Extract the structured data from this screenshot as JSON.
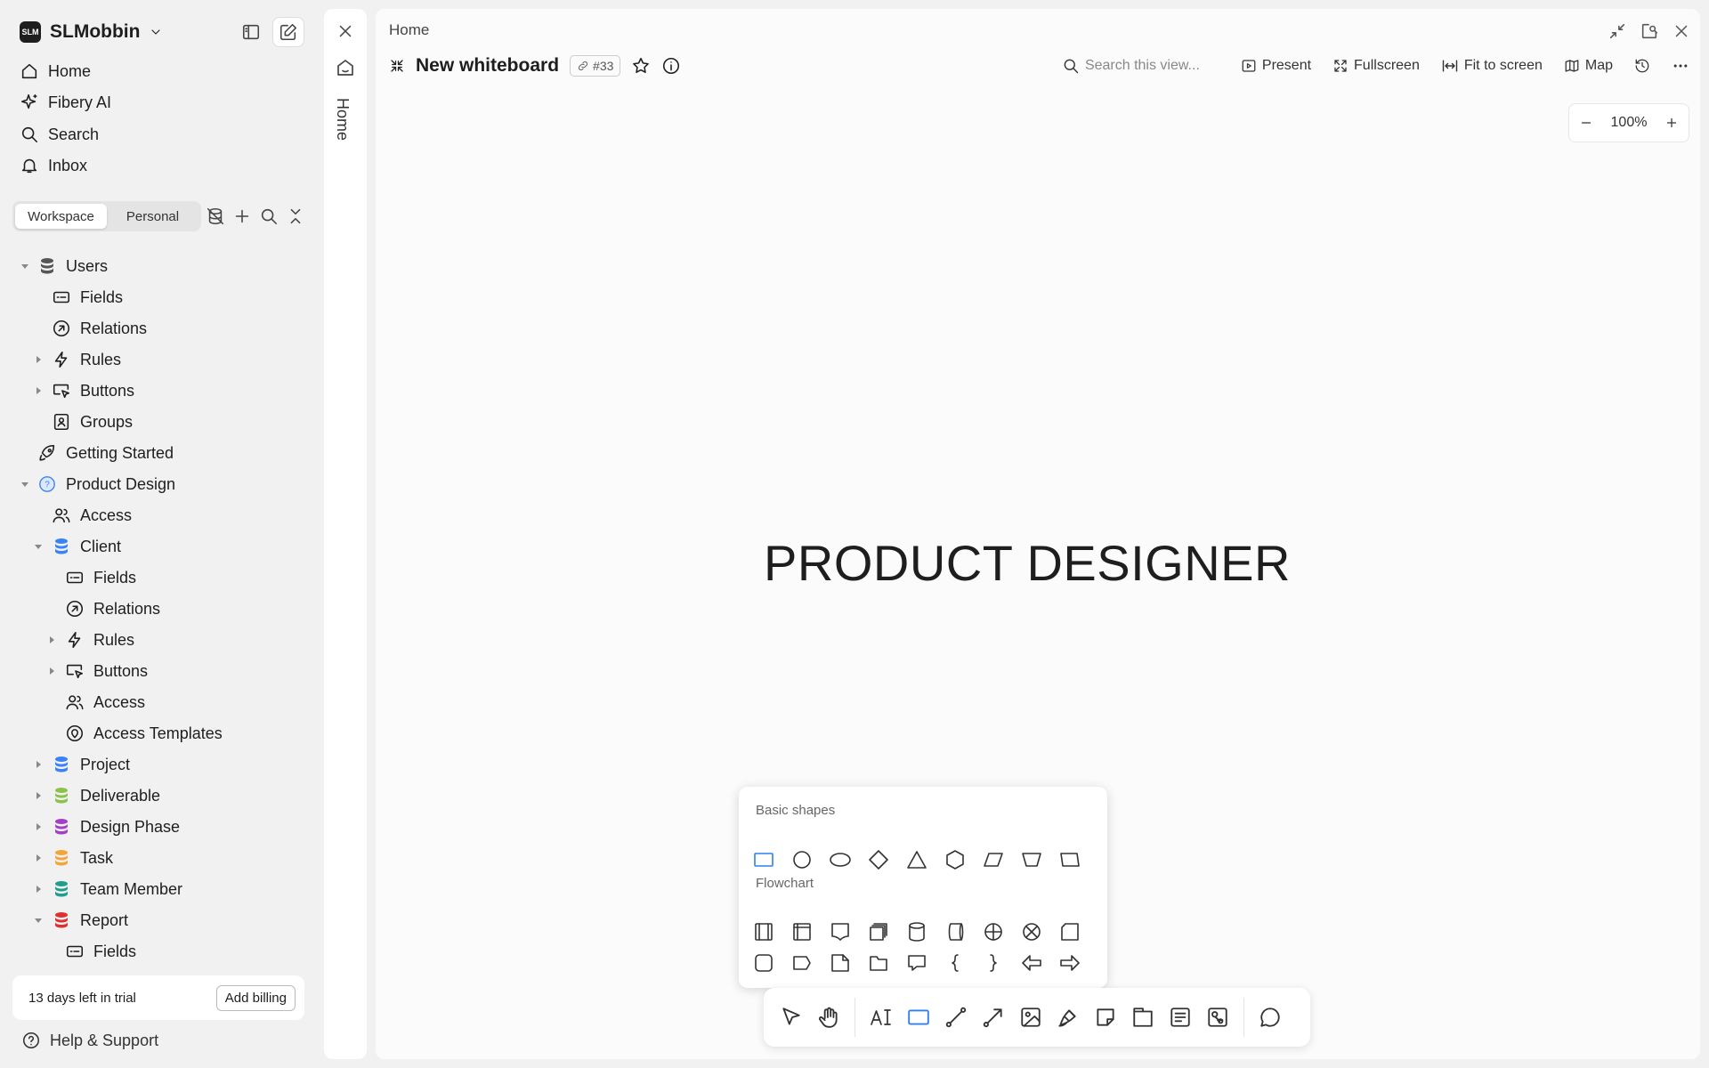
{
  "workspace": {
    "name": "SLMobbin",
    "logo_text": "SLM"
  },
  "nav": [
    {
      "label": "Home",
      "icon": "home-icon"
    },
    {
      "label": "Fibery AI",
      "icon": "sparkle-icon"
    },
    {
      "label": "Search",
      "icon": "search-icon"
    },
    {
      "label": "Inbox",
      "icon": "bell-icon"
    }
  ],
  "tabs": {
    "workspace": "Workspace",
    "personal": "Personal"
  },
  "tree": [
    {
      "label": "Users"
    },
    {
      "label": "Fields"
    },
    {
      "label": "Relations"
    },
    {
      "label": "Rules"
    },
    {
      "label": "Buttons"
    },
    {
      "label": "Groups"
    },
    {
      "label": "Getting Started"
    },
    {
      "label": "Product Design"
    },
    {
      "label": "Access"
    },
    {
      "label": "Client"
    },
    {
      "label": "Fields"
    },
    {
      "label": "Relations"
    },
    {
      "label": "Rules"
    },
    {
      "label": "Buttons"
    },
    {
      "label": "Access"
    },
    {
      "label": "Access Templates"
    },
    {
      "label": "Project"
    },
    {
      "label": "Deliverable"
    },
    {
      "label": "Design Phase"
    },
    {
      "label": "Task"
    },
    {
      "label": "Team Member"
    },
    {
      "label": "Report"
    },
    {
      "label": "Fields"
    }
  ],
  "colors": {
    "users_db": "#555555",
    "client_db": "#3b82f6",
    "project_db": "#3b82f6",
    "deliverable_db": "#8bc34a",
    "design_phase_db": "#a43fc6",
    "task_db": "#f2a63a",
    "team_member_db": "#1f9e8c",
    "report_db": "#e02f2f",
    "accent": "#2f80ed"
  },
  "trial": {
    "text": "13 days left in trial",
    "button": "Add billing"
  },
  "help": "Help & Support",
  "strip": {
    "label": "Home"
  },
  "main": {
    "breadcrumb": "Home",
    "title": "New whiteboard",
    "id_badge": "#33",
    "search_placeholder": "Search this view...",
    "toolbar": {
      "present": "Present",
      "fullscreen": "Fullscreen",
      "fit": "Fit to screen",
      "map": "Map"
    },
    "zoom": "100%",
    "canvas_text": "PRODUCT DESIGNER"
  },
  "shapes_popover": {
    "basic_label": "Basic shapes",
    "flowchart_label": "Flowchart"
  }
}
